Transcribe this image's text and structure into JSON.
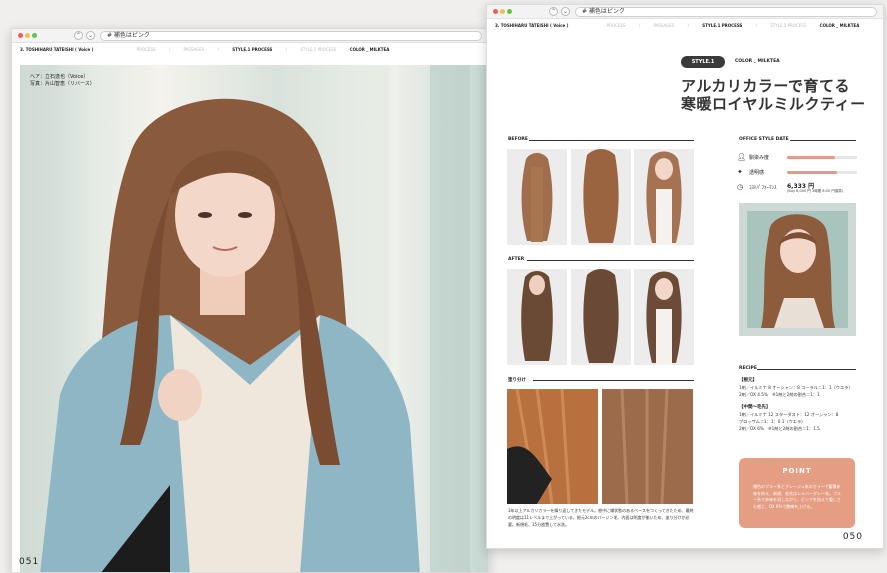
{
  "left_page": {
    "address": "# 補色はピンク",
    "nav": [
      "3. TOSHIHARU TATEISHI ( Voice )",
      "PROCESS",
      "/",
      "PASSAGES",
      "/",
      "STYLE.1  PROCESS",
      "/",
      "STYLE.2  PROCESS",
      "COLOR _ MILKTEA"
    ],
    "credit_hair": "ヘア：立石逸也（Voice）",
    "credit_photo": "写真：片山智恵（リバース）",
    "page_number": "051"
  },
  "right_page": {
    "address": "# 補色はピンク",
    "nav": [
      "3. TOSHIHARU TATEISHI ( Voice )",
      "PROCESS",
      "/",
      "PASSAGES",
      "/",
      "STYLE.1  PROCESS",
      "/",
      "STYLE.2  PROCESS",
      "COLOR _ MILKTEA"
    ],
    "style_badge": "STYLE.1",
    "color_label": "COLOR _ MILKTEA",
    "headline_line1": "アルカリカラーで育てる",
    "headline_line2": "寒暖ロイヤルミルクティー",
    "before_label": "BEFORE",
    "after_label": "AFTER",
    "process_label": "塗り分け",
    "process_note": "3年以上アルカリカラーを繰り返してきたモデル。根中に繊状態のあるベースをつくってきたため、最終の明度は11レベルまで上がっている。根元2cmのバージン毛、内面は明度が揃いため、塗り分けが必要。新規毛、15分放置して水洗。",
    "office_style_label": "OFFICE STYLE DATE",
    "meters": [
      {
        "icon": "person-icon",
        "label": "馴染み度",
        "value": 0.68
      },
      {
        "icon": "sparkle-icon",
        "label": "透明感",
        "value": 0.72
      }
    ],
    "cost_label": "ｺｽﾄﾊﾟﾌｫｰﾏﾝｽ",
    "price": "6,333 円",
    "price_note": "(Buy 8,000 円  3時間 6:00 円換算)",
    "recipe_label": "RECIPE",
    "recipe": [
      {
        "title": "【根元】",
        "lines": [
          "1剤／イルミナ 8 オーシャン：8 コーラル＝1：1（ウエラ）",
          "2剤／OX 4.5%　※1剤と2剤の割合＝1：1"
        ]
      },
      {
        "title": "【中間～毛先】",
        "lines": [
          "1剤／イルミナ 12 スターダスト：12 オーシャン：8",
          "ブロッサム＝1：1：0.1（ウエラ）",
          "2剤／OX 6%　※1剤と2剤の割合＝1：1.5"
        ]
      }
    ],
    "point_title": "POINT",
    "point_text": "補色のブルー系とグレージュ系のカラーで蓄積赤味を抑え、新規、毛先はシルバーグレー系。ブルー系で赤味を消しながら、ピンクを加えて優しさも感じ、OX 6%で艶感を上げる。",
    "page_number": "050"
  },
  "colors": {
    "badge_bg": "#3a3a3a",
    "point_bg": "#e59d83",
    "meter_fill": "#e09c84",
    "hair": "#8a5a3c"
  }
}
